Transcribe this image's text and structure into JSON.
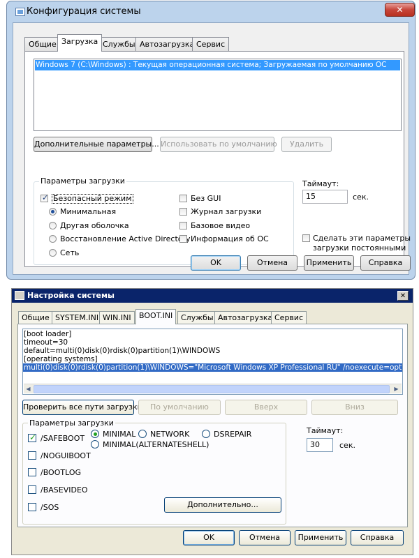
{
  "win7": {
    "title": "Конфигурация системы",
    "close_icon": "✕",
    "tabs": [
      "Общие",
      "Загрузка",
      "Службы",
      "Автозагрузка",
      "Сервис"
    ],
    "active_tab": "Загрузка",
    "boot_entry": "Windows 7 (C:\\Windows) : Текущая операционная система; Загружаемая по умолчанию ОС",
    "buttons": {
      "advanced": "Дополнительные параметры...",
      "set_default": "Использовать по умолчанию",
      "delete": "Удалить"
    },
    "boot_options_title": "Параметры загрузки",
    "safe_boot": "Безопасный режим",
    "safe_boot_checked": true,
    "radios": [
      "Минимальная",
      "Другая оболочка",
      "Восстановление Active Directory",
      "Сеть"
    ],
    "radio_selected": "Минимальная",
    "right_checks": [
      "Без GUI",
      "Журнал загрузки",
      "Базовое видео",
      "Информация  об ОС"
    ],
    "timeout_label": "Таймаут:",
    "timeout_value": "15",
    "timeout_unit": "сек.",
    "permanent_line1": "Сделать эти параметры",
    "permanent_line2": "загрузки постоянными",
    "footer": {
      "ok": "OK",
      "cancel": "Отмена",
      "apply": "Применить",
      "help": "Справка"
    }
  },
  "winxp": {
    "title": "Настройка системы",
    "close_icon": "✕",
    "tabs": [
      "Общие",
      "SYSTEM.INI",
      "WIN.INI",
      "BOOT.INI",
      "Службы",
      "Автозагрузка",
      "Сервис"
    ],
    "active_tab": "BOOT.INI",
    "boot_ini_lines": [
      "[boot loader]",
      "timeout=30",
      "default=multi(0)disk(0)rdisk(0)partition(1)\\WINDOWS",
      "[operating systems]",
      "multi(0)disk(0)rdisk(0)partition(1)\\WINDOWS=\"Microsoft Windows XP Professional RU\" /noexecute=optin /fastdetect"
    ],
    "selected_line_index": 4,
    "scroll_left_icon": "◀",
    "scroll_right_icon": "▶",
    "buttons": {
      "check_paths": "Проверить все пути загрузки",
      "default": "По умолчанию",
      "up": "Вверх",
      "down": "Вниз",
      "advanced": "Дополнительно..."
    },
    "boot_options_title": "Параметры загрузки",
    "checks": [
      "/SAFEBOOT",
      "/NOGUIBOOT",
      "/BOOTLOG",
      "/BASEVIDEO",
      "/SOS"
    ],
    "safeboot_checked": true,
    "radios": [
      "MINIMAL",
      "NETWORK",
      "DSREPAIR",
      "MINIMAL(ALTERNATESHELL)"
    ],
    "radio_selected": "MINIMAL",
    "timeout_label": "Таймаут:",
    "timeout_value": "30",
    "timeout_unit": "сек.",
    "footer": {
      "ok": "OK",
      "cancel": "Отмена",
      "apply": "Применить",
      "help": "Справка"
    }
  }
}
